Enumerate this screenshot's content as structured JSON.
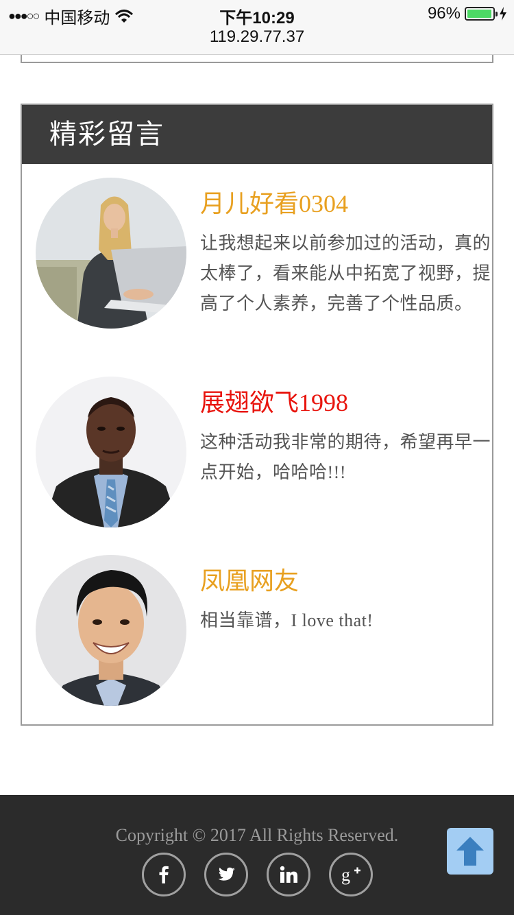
{
  "status_bar": {
    "signal_dots": "●●●○○",
    "carrier": "中国移动",
    "time": "下午10:29",
    "url": "119.29.77.37",
    "battery_percent": "96%",
    "battery_level": 0.96,
    "battery_color": "#4cd964"
  },
  "comments_section": {
    "title": "精彩留言",
    "header_bg": "#3c3c3c",
    "items": [
      {
        "name": "月儿好看0304",
        "name_color": "#e8a020",
        "text": "让我想起来以前参加过的活动，真的太棒了，看来能从中拓宽了视野，提高了个人素养，完善了个性品质。",
        "avatar": "woman-with-laptop-photo"
      },
      {
        "name": "展翅欲飞1998",
        "name_color": "#e8150e",
        "text": "这种活动我非常的期待，希望再早一点开始，哈哈哈!!!",
        "avatar": "man-in-suit-photo"
      },
      {
        "name": "凤凰网友",
        "name_color": "#e8a020",
        "text": "相当靠谱，I love that!",
        "avatar": "smiling-man-photo"
      }
    ]
  },
  "footer": {
    "copyright": "Copyright © 2017 All Rights Reserved.",
    "social_icons": [
      "facebook-icon",
      "twitter-icon",
      "linkedin-icon",
      "google-plus-icon"
    ],
    "back_to_top_icon": "arrow-up-icon",
    "back_to_top_color": "#a3cdf3"
  }
}
